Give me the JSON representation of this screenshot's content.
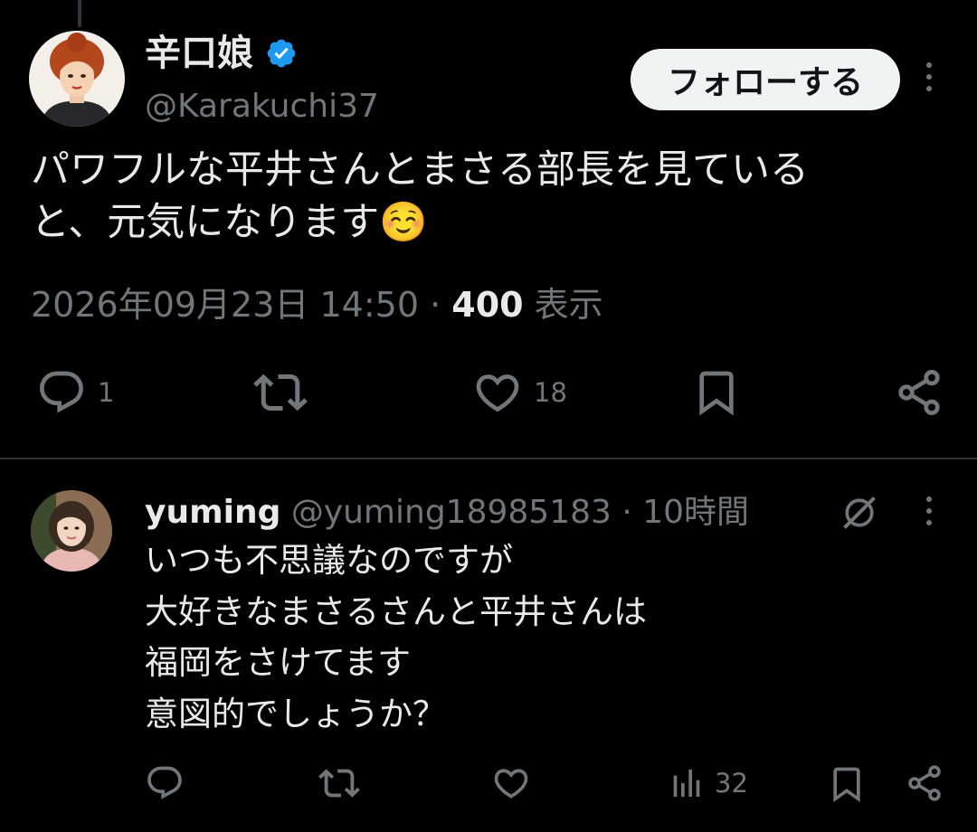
{
  "main_tweet": {
    "display_name": "辛口娘",
    "handle": "@Karakuchi37",
    "follow_label": "フォローする",
    "text_line1": "パワフルな平井さんとまさる部長を見ている",
    "text_line2": "と、元気になります☺️",
    "timestamp": "2026年09月23日 14:50",
    "separator": " · ",
    "views_count": "400",
    "views_label": " 表示",
    "actions": {
      "reply_count": "1",
      "retweet_count": "",
      "like_count": "18"
    }
  },
  "reply_tweet": {
    "display_name": "yuming",
    "handle": "@yuming18985183",
    "time_sep": " · ",
    "time": "10時間",
    "lines": [
      "いつも不思議なのですが",
      "大好きなまさるさんと平井さんは",
      "福岡をさけてます",
      "意図的でしょうか？"
    ],
    "actions": {
      "views_count": "32"
    }
  },
  "colors": {
    "background": "#000000",
    "text": "#e7e9ea",
    "secondary": "#71767b",
    "verified": "#1d9bf0",
    "button_bg": "#eff3f4"
  },
  "icons": [
    "verified-badge-icon",
    "reply-icon",
    "retweet-icon",
    "like-icon",
    "bookmark-icon",
    "share-icon",
    "more-icon",
    "views-icon",
    "grok-icon"
  ]
}
